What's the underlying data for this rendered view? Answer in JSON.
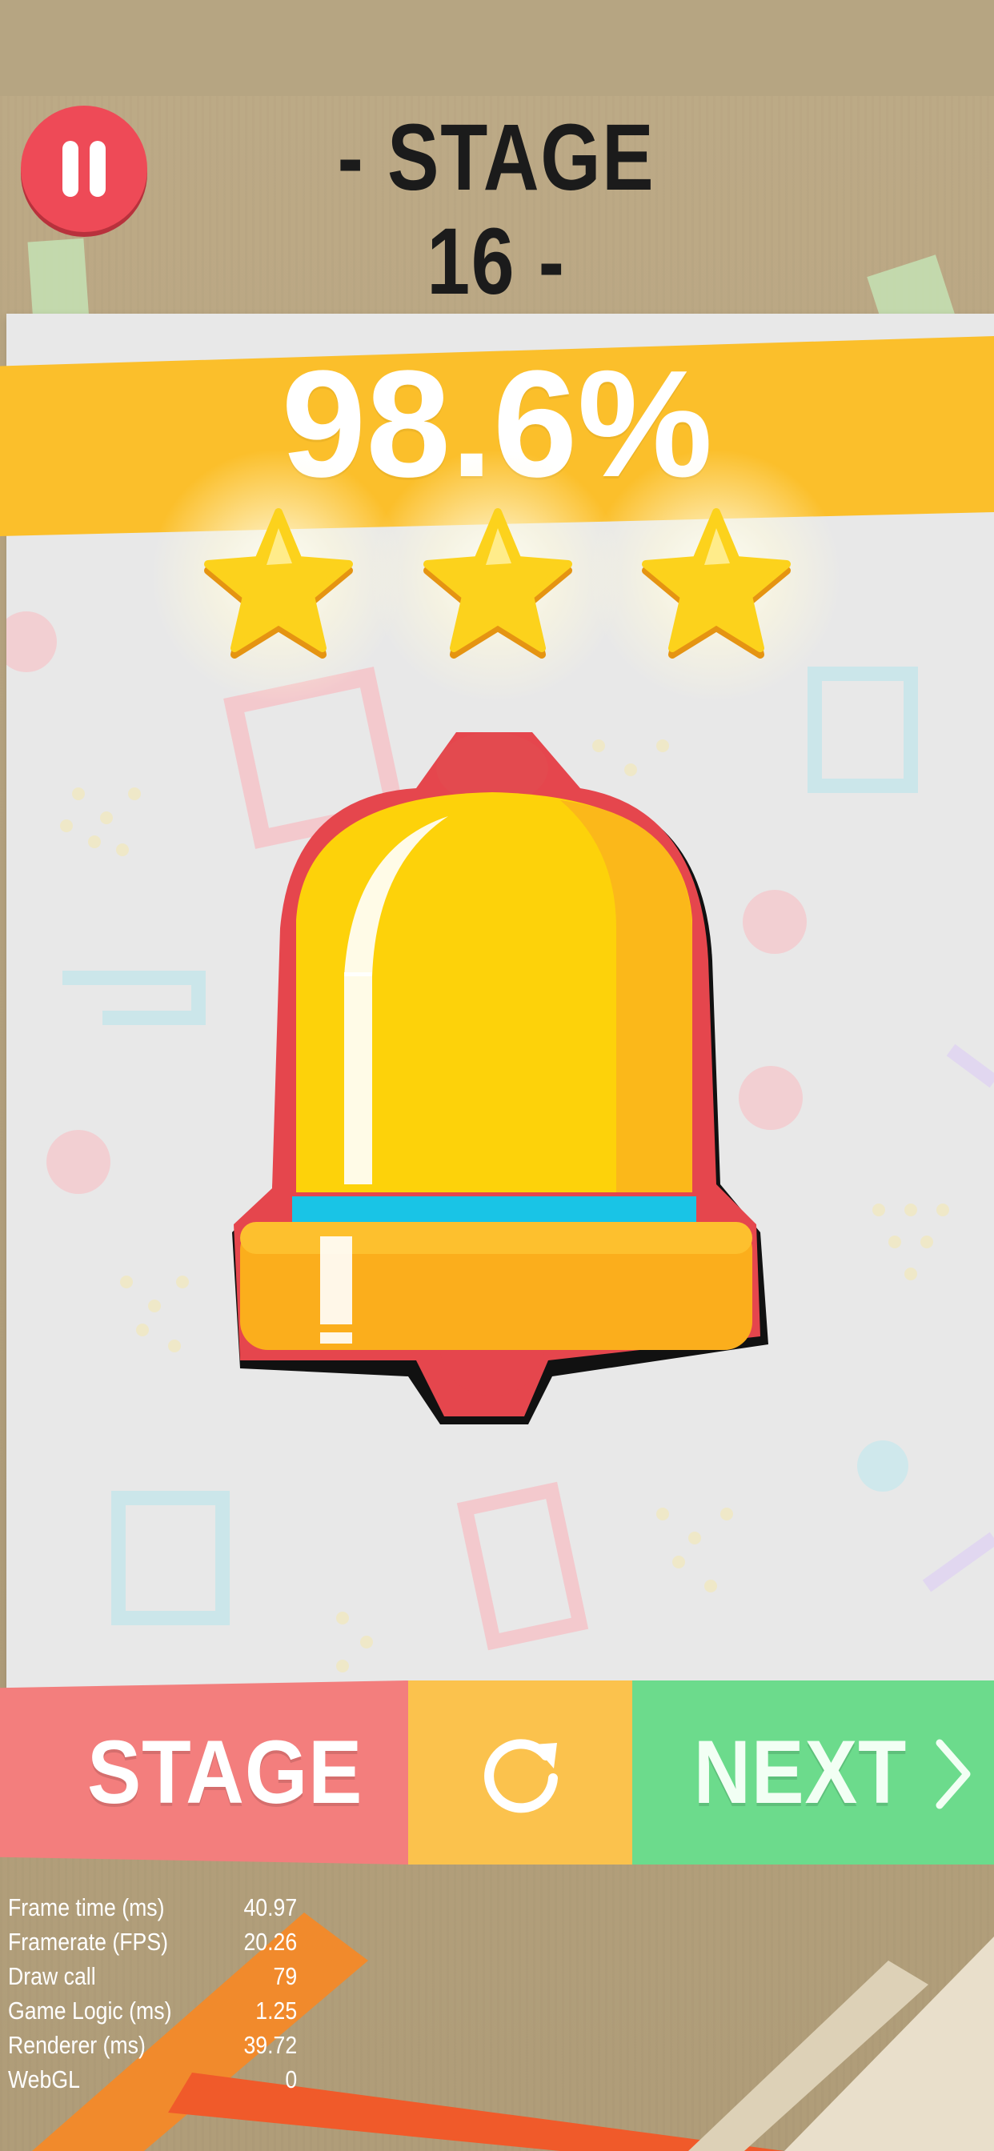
{
  "header": {
    "stage_title": "- STAGE 16 -"
  },
  "result": {
    "percent": "98.6%",
    "stars_earned": 3,
    "stars_total": 3
  },
  "buttons": {
    "stage_label": "STAGE",
    "next_label": "NEXT"
  },
  "debug_stats": [
    {
      "label": "Frame time (ms)",
      "value": "40.97"
    },
    {
      "label": "Framerate (FPS)",
      "value": "20.26"
    },
    {
      "label": "Draw call",
      "value": "79"
    },
    {
      "label": "Game Logic (ms)",
      "value": "1.25"
    },
    {
      "label": "Renderer (ms)",
      "value": "39.72"
    },
    {
      "label": "WebGL",
      "value": "0"
    }
  ],
  "colors": {
    "ribbon": "#fbbf2b",
    "pause_button": "#ee4a57",
    "stage_button": "#f37e7d",
    "restart_button": "#fbc24d",
    "next_button": "#6cdb8c",
    "bell": "#fdd20a",
    "bell_outline": "#e0424a"
  },
  "icons": {
    "pause": "pause-icon",
    "restart": "restart-icon",
    "next": "chevron-right-icon",
    "star": "star-icon",
    "bell": "bell-icon"
  }
}
